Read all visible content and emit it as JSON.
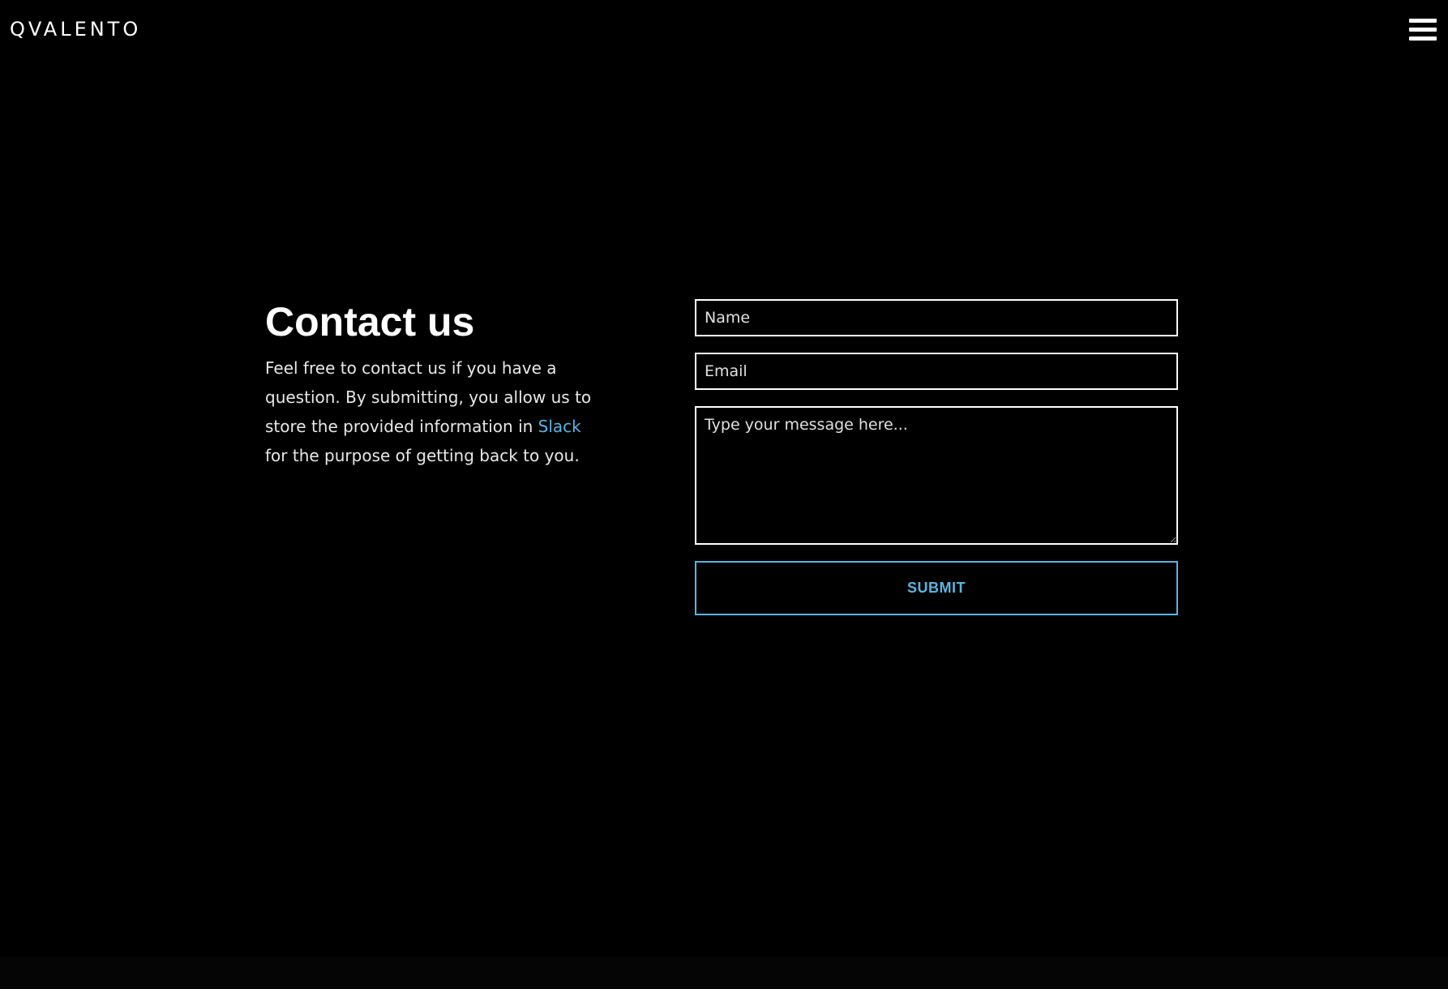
{
  "header": {
    "logo_text": "QVALENTO",
    "menu_icon": "hamburger-menu-icon"
  },
  "contact": {
    "title": "Contact us",
    "text_before_link": "Feel free to contact us if you have a question. By submitting, you allow us to store the provided information in ",
    "link_text": "Slack",
    "text_after_link": " for the purpose of getting back to you."
  },
  "form": {
    "name_placeholder": "Name",
    "email_placeholder": "Email",
    "message_placeholder": "Type your message here...",
    "submit_label": "SUBMIT"
  },
  "colors": {
    "background": "#000000",
    "text": "#ffffff",
    "accent": "#5ab4e0"
  }
}
